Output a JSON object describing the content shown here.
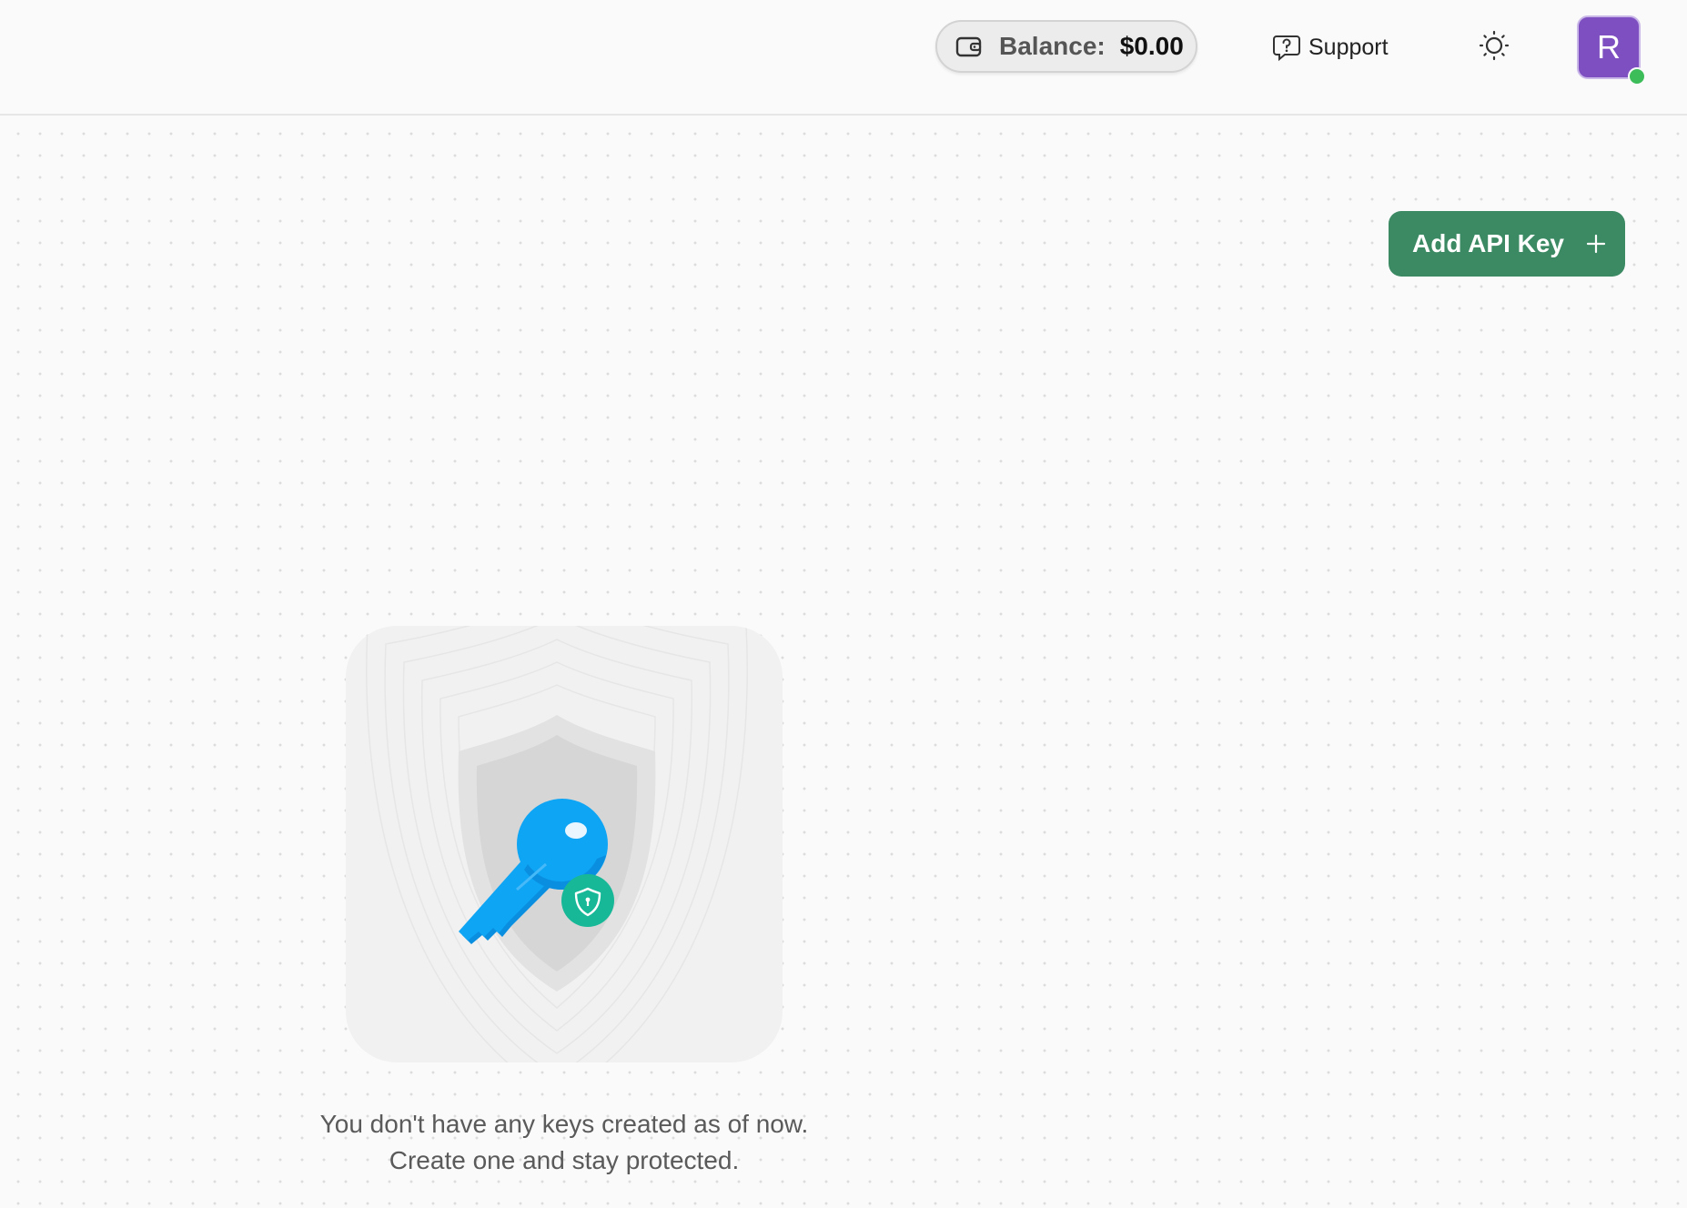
{
  "header": {
    "balance_label": "Balance:",
    "balance_value": "$0.00",
    "support_label": "Support",
    "avatar_initial": "R",
    "avatar_color": "#7d4fc1",
    "status_color": "#3dbd5a",
    "icons": {
      "wallet": "wallet-icon",
      "support": "help-chat-icon",
      "theme": "sun-icon"
    }
  },
  "main": {
    "add_button_label": "Add API Key",
    "add_button_color": "#3b8a63",
    "empty_state": {
      "line1": "You don't have any keys created as of now.",
      "line2": "Create one and stay protected.",
      "illustration": "shield-key-icon",
      "key_color": "#0ea5f5",
      "badge_color": "#17b897"
    }
  }
}
